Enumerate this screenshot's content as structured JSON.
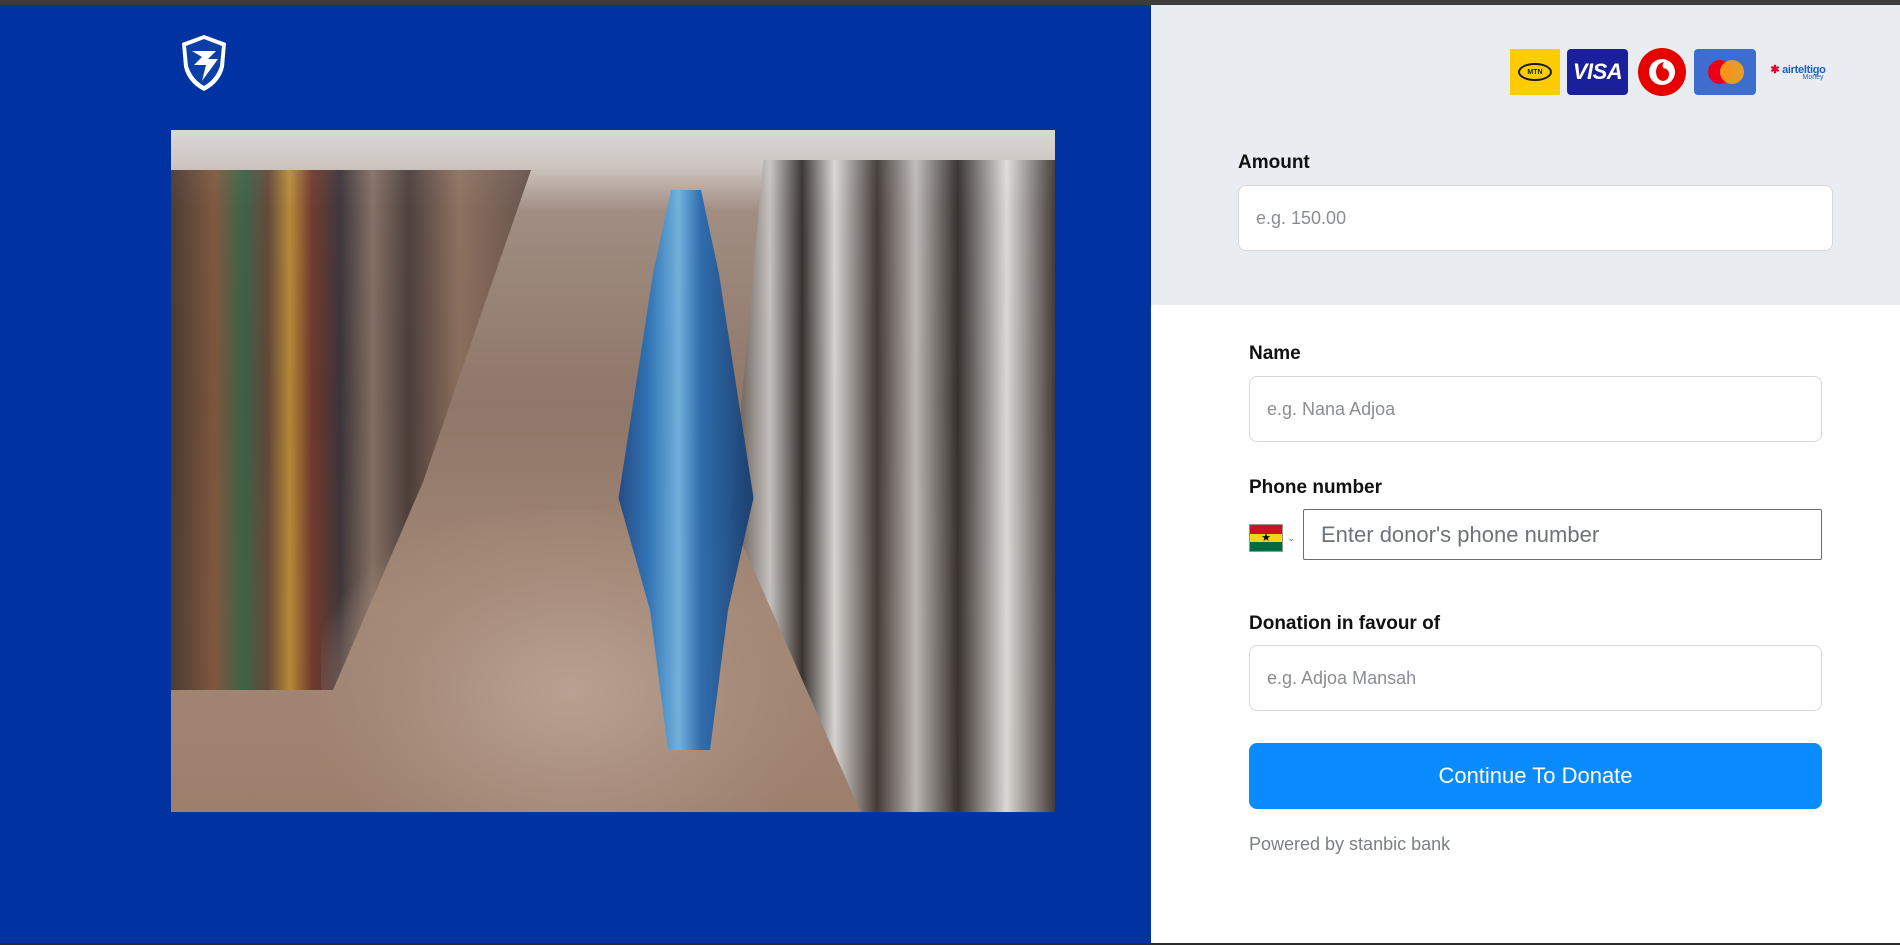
{
  "brand": {
    "bank_logo_icon": "stanbic-shield-logo",
    "hero_image": "crowd-photo"
  },
  "payment_methods": [
    {
      "name": "mtn-logo",
      "text": "MTN"
    },
    {
      "name": "visa-logo",
      "text": "VISA"
    },
    {
      "name": "vodafone-logo",
      "text": ""
    },
    {
      "name": "mastercard-logo",
      "text": ""
    },
    {
      "name": "airteltigo-logo",
      "text": "airteltigo",
      "sub": "Money"
    }
  ],
  "form": {
    "amount": {
      "label": "Amount",
      "placeholder": "e.g. 150.00",
      "value": ""
    },
    "name": {
      "label": "Name",
      "placeholder": "e.g. Nana Adjoa",
      "value": ""
    },
    "phone": {
      "label": "Phone number",
      "placeholder": "Enter donor's phone number",
      "country": "Ghana",
      "value": ""
    },
    "favour": {
      "label": "Donation in favour of",
      "placeholder": "e.g. Adjoa Mansah",
      "value": ""
    },
    "submit_label": "Continue To Donate"
  },
  "footer": {
    "powered_by": "Powered by stanbic bank"
  },
  "colors": {
    "left_panel": "#0033a1",
    "amount_section": "#e9edf1",
    "button": "#0a8bfd"
  }
}
